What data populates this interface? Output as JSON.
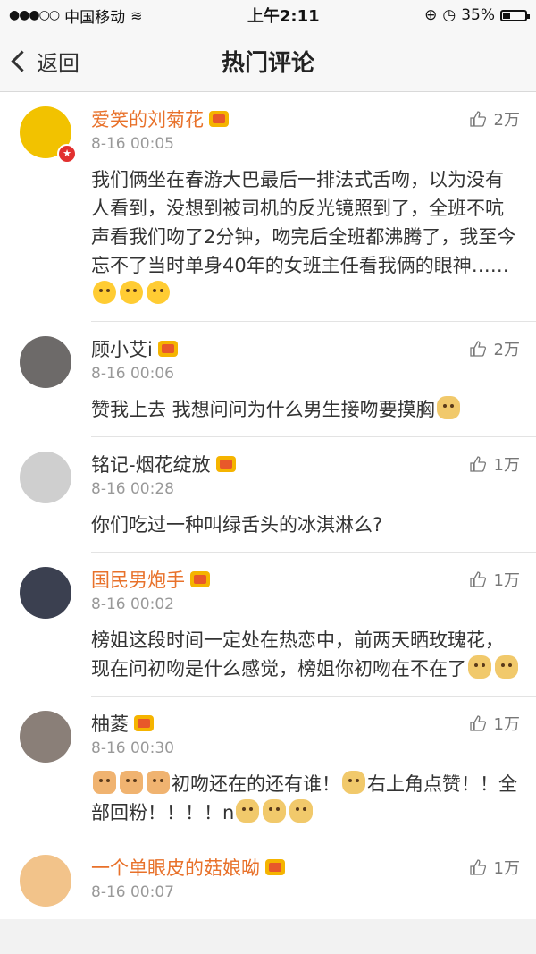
{
  "status_bar": {
    "carrier": "中国移动",
    "time": "上午2:11",
    "battery": "35%",
    "battery_level": 0.35
  },
  "nav": {
    "back_label": "返回",
    "title": "热门评论"
  },
  "comments": [
    {
      "name": "爱笑的刘菊花",
      "name_color": "orange",
      "time": "8-16 00:05",
      "likes": "2万",
      "text": "我们俩坐在春游大巴最后一排法式舌吻，以为没有人看到，没想到被司机的反光镜照到了，全班不吭声看我们吻了2分钟，吻完后全班都沸腾了，我至今忘不了当时单身40年的女班主任看我俩的眼神……",
      "avatar_color": "#f2c200",
      "emojis": [
        "yellow",
        "yellow",
        "yellow"
      ]
    },
    {
      "name": "顾小艾i",
      "name_color": "dark",
      "time": "8-16 00:06",
      "likes": "2万",
      "text": "赞我上去 我想问问为什么男生接吻要摸胸",
      "avatar_color": "#6d6a69",
      "emojis": [
        "dog"
      ]
    },
    {
      "name": "铭记-烟花绽放",
      "name_color": "dark",
      "time": "8-16 00:28",
      "likes": "1万",
      "text": "你们吃过一种叫绿舌头的冰淇淋么?",
      "avatar_color": "#cfcfcf",
      "emojis": []
    },
    {
      "name": "国民男炮手",
      "name_color": "orange",
      "time": "8-16 00:02",
      "likes": "1万",
      "text": "榜姐这段时间一定处在热恋中，前两天晒玫瑰花，现在问初吻是什么感觉，榜姐你初吻在不在了",
      "avatar_color": "#3b4050",
      "emojis": [
        "dog",
        "dog"
      ]
    },
    {
      "name": "柚菱",
      "name_color": "dark",
      "time": "8-16 00:30",
      "likes": "1万",
      "text_prefix_emojis": [
        "cat",
        "cat",
        "cat"
      ],
      "text": "初吻还在的还有谁！",
      "text2": "右上角点赞！！全部回粉！！！！n",
      "avatar_color": "#8a7f78",
      "emojis": [
        "dog"
      ],
      "emojis_end": [
        "dog",
        "dog",
        "dog"
      ]
    },
    {
      "name": "一个单眼皮的菇娘呦",
      "name_color": "orange",
      "time": "8-16 00:07",
      "likes": "1万",
      "text": "",
      "avatar_color": "#f2c38a",
      "emojis": []
    }
  ]
}
